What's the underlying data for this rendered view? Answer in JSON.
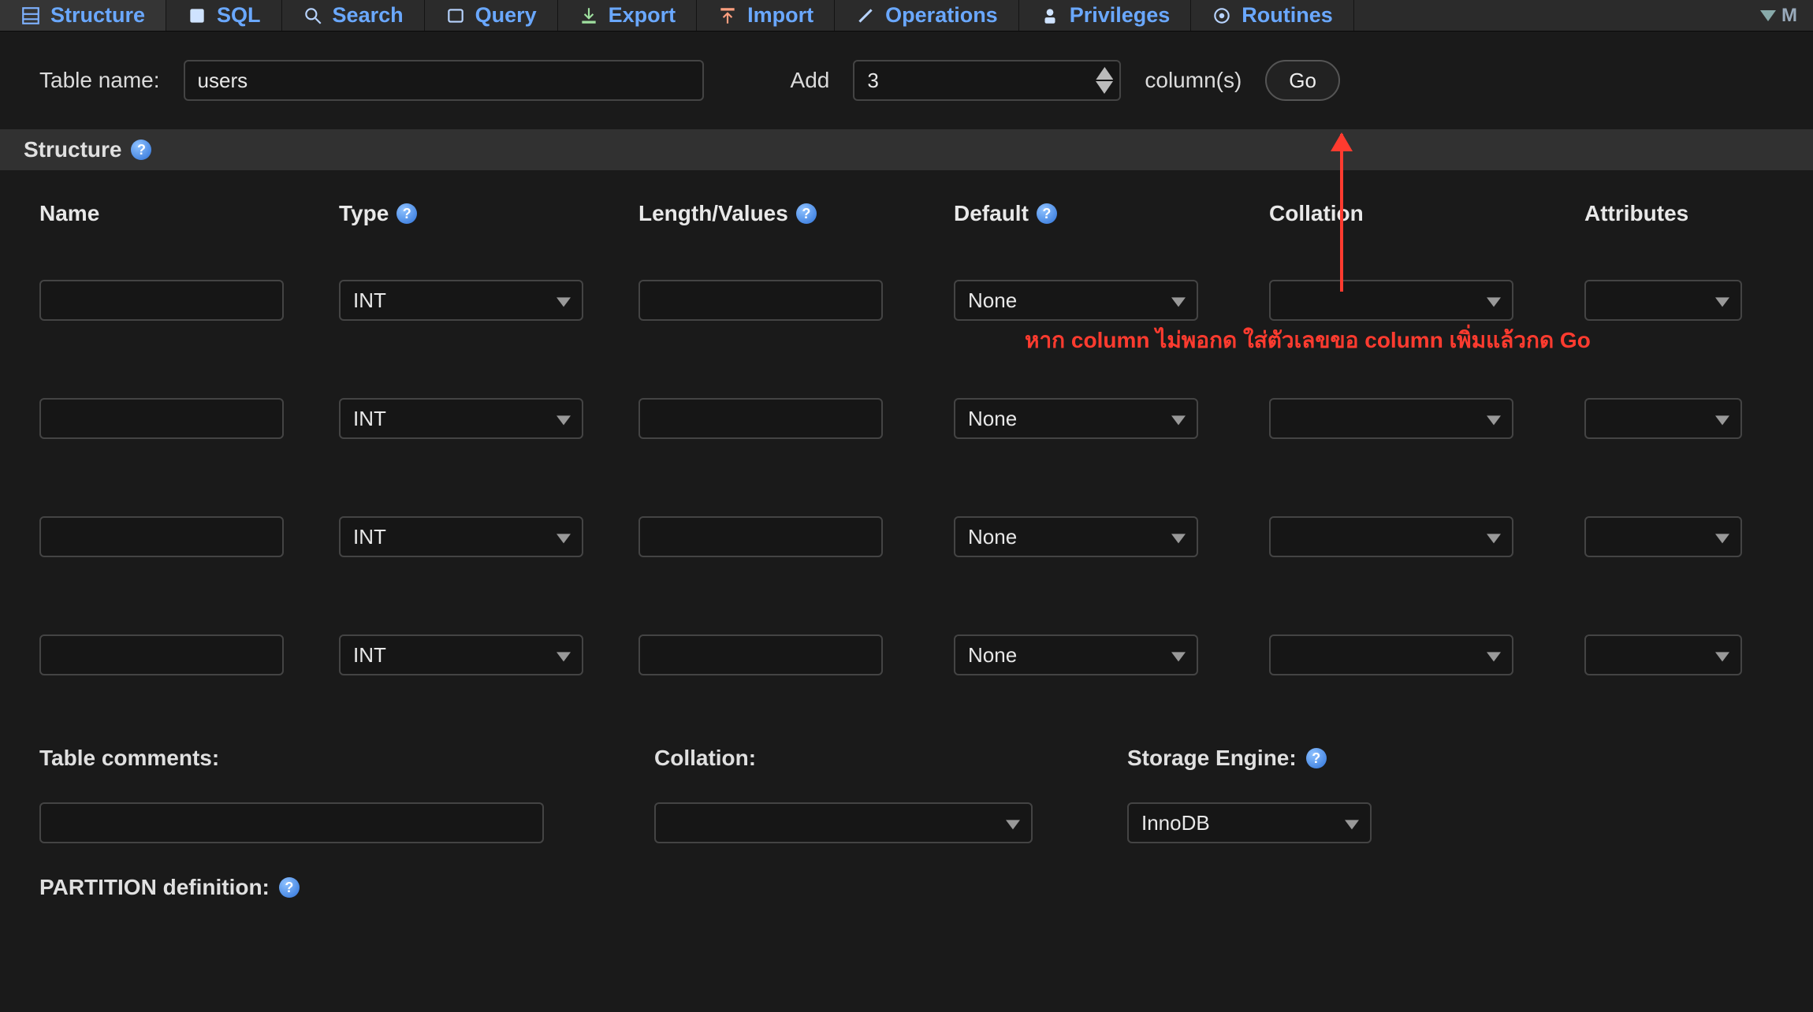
{
  "tabs": {
    "items": [
      {
        "label": "Structure",
        "icon": "structure-icon",
        "active": true
      },
      {
        "label": "SQL",
        "icon": "sql-icon"
      },
      {
        "label": "Search",
        "icon": "search-icon"
      },
      {
        "label": "Query",
        "icon": "query-icon"
      },
      {
        "label": "Export",
        "icon": "export-icon"
      },
      {
        "label": "Import",
        "icon": "import-icon"
      },
      {
        "label": "Operations",
        "icon": "operations-icon"
      },
      {
        "label": "Privileges",
        "icon": "privileges-icon"
      },
      {
        "label": "Routines",
        "icon": "routines-icon"
      }
    ],
    "more_label": "M"
  },
  "top_form": {
    "table_name_label": "Table name:",
    "table_name_value": "users",
    "add_label": "Add",
    "add_columns_value": "3",
    "columns_label": "column(s)",
    "go_label": "Go"
  },
  "section": {
    "structure_label": "Structure"
  },
  "columns_header": {
    "name": "Name",
    "type": "Type",
    "length": "Length/Values",
    "default": "Default",
    "collation": "Collation",
    "attributes": "Attributes"
  },
  "rows": [
    {
      "name": "",
      "type": "INT",
      "length": "",
      "default": "None",
      "collation": "",
      "attributes": ""
    },
    {
      "name": "",
      "type": "INT",
      "length": "",
      "default": "None",
      "collation": "",
      "attributes": ""
    },
    {
      "name": "",
      "type": "INT",
      "length": "",
      "default": "None",
      "collation": "",
      "attributes": ""
    },
    {
      "name": "",
      "type": "INT",
      "length": "",
      "default": "None",
      "collation": "",
      "attributes": ""
    }
  ],
  "bottom": {
    "table_comments_label": "Table comments:",
    "table_comments_value": "",
    "collation_label": "Collation:",
    "collation_value": "",
    "storage_engine_label": "Storage Engine:",
    "storage_engine_value": "InnoDB"
  },
  "partition": {
    "label": "PARTITION definition:"
  },
  "annotation": {
    "text": "หาก column ไม่พอกด ใส่ตัวเลขขอ column เพิ่มแล้วกด Go"
  },
  "colors": {
    "tab_text": "#6aa8ff",
    "annotation": "#ff3b2f"
  }
}
